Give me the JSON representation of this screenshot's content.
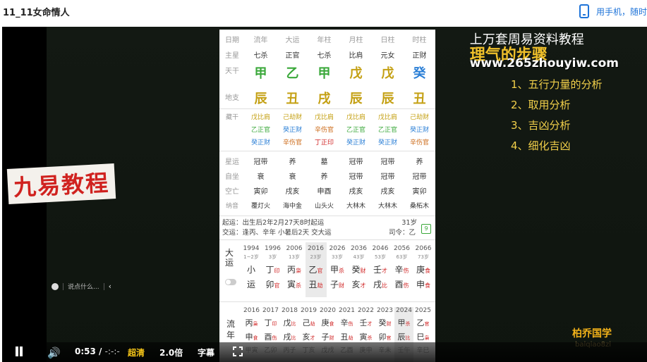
{
  "page": {
    "title": "11_11女命情人",
    "mobile_link": "用手机，随时"
  },
  "video": {
    "brand_banner": "九易教程",
    "watermark": {
      "line1": "上万套周易资料教程",
      "line2": "理气的步骤",
      "line3": "www.265zhouyiw.com"
    },
    "steps": [
      "1、五行力量的分析",
      "2、取用分析",
      "3、吉凶分析",
      "4、细化吉凶"
    ],
    "bottom_brand": "柏乔国学",
    "bottom_brand_pinyin": "baiqiao8zi"
  },
  "chart": {
    "header": [
      "日期",
      "流年",
      "大运",
      "年柱",
      "月柱",
      "日柱",
      "时柱"
    ],
    "zhuxing": {
      "label": "主星",
      "values": [
        "七杀",
        "正官",
        "七杀",
        "比肩",
        "元女",
        "正财"
      ]
    },
    "tiangan": {
      "label": "天干",
      "values": [
        "甲",
        "乙",
        "甲",
        "戊",
        "戊",
        "癸"
      ]
    },
    "dizhi": {
      "label": "地支",
      "values": [
        "辰",
        "丑",
        "戌",
        "辰",
        "辰",
        "丑"
      ]
    },
    "canggan": {
      "label": "藏干",
      "cols": [
        [
          "戊比肩",
          "乙正官",
          "癸正财"
        ],
        [
          "己劫财",
          "癸正财",
          "辛伤官"
        ],
        [
          "戊比肩",
          "辛伤官",
          "丁正印"
        ],
        [
          "戊比肩",
          "乙正官",
          "癸正财"
        ],
        [
          "戊比肩",
          "乙正官",
          "癸正财"
        ],
        [
          "己劫财",
          "癸正财",
          "辛伤官"
        ]
      ]
    },
    "xingyun": {
      "label": "星运",
      "values": [
        "冠带",
        "养",
        "墓",
        "冠带",
        "冠带",
        "养"
      ]
    },
    "zizuo": {
      "label": "自坐",
      "values": [
        "衰",
        "衰",
        "养",
        "冠带",
        "冠带",
        "冠带"
      ]
    },
    "kongwang": {
      "label": "空亡",
      "values": [
        "寅卯",
        "戌亥",
        "申酉",
        "戌亥",
        "戌亥",
        "寅卯"
      ]
    },
    "nayin": {
      "label": "纳音",
      "values": [
        "覆灯火",
        "海中金",
        "山头火",
        "大林木",
        "大林木",
        "桑柘木"
      ]
    },
    "qiyun": "起运：出生后2年2月27天8时起运",
    "jiaoyun": "交运：逢丙、辛年 小暑后2天 交大运",
    "qiyun_age": "31岁",
    "siling": "司令：乙",
    "badge": "9",
    "dayun": {
      "label": "大运",
      "cols": [
        {
          "year": "1994",
          "age": "1~2岁",
          "gan": "小",
          "zhi": "运",
          "gan_ss": "",
          "zhi_ss": ""
        },
        {
          "year": "1996",
          "age": "3岁",
          "gan": "丁",
          "zhi": "卯",
          "gan_ss": "印",
          "zhi_ss": "官"
        },
        {
          "year": "2006",
          "age": "13岁",
          "gan": "丙",
          "zhi": "寅",
          "gan_ss": "枭",
          "zhi_ss": "杀"
        },
        {
          "year": "2016",
          "age": "23岁",
          "gan": "乙",
          "zhi": "丑",
          "gan_ss": "官",
          "zhi_ss": "劫"
        },
        {
          "year": "2026",
          "age": "33岁",
          "gan": "甲",
          "zhi": "子",
          "gan_ss": "杀",
          "zhi_ss": "财"
        },
        {
          "year": "2036",
          "age": "43岁",
          "gan": "癸",
          "zhi": "亥",
          "gan_ss": "财",
          "zhi_ss": "才"
        },
        {
          "year": "2046",
          "age": "53岁",
          "gan": "壬",
          "zhi": "戌",
          "gan_ss": "才",
          "zhi_ss": "比"
        },
        {
          "year": "2056",
          "age": "63岁",
          "gan": "辛",
          "zhi": "酉",
          "gan_ss": "伤",
          "zhi_ss": "伤"
        },
        {
          "year": "2066",
          "age": "73岁",
          "gan": "庚",
          "zhi": "申",
          "gan_ss": "食",
          "zhi_ss": "食"
        }
      ]
    },
    "liunian": {
      "label": "流年",
      "cols": [
        {
          "year": "2016",
          "gan": "丙",
          "gan_ss": "枭",
          "zhi": "申",
          "zhi_ss": "食",
          "sub": "甲寅"
        },
        {
          "year": "2017",
          "gan": "丁",
          "gan_ss": "印",
          "zhi": "酉",
          "zhi_ss": "伤",
          "sub": "乙卯"
        },
        {
          "year": "2018",
          "gan": "戊",
          "gan_ss": "比",
          "zhi": "戌",
          "zhi_ss": "比",
          "sub": "丙子"
        },
        {
          "year": "2019",
          "gan": "己",
          "gan_ss": "劫",
          "zhi": "亥",
          "zhi_ss": "才",
          "sub": "丁亥"
        },
        {
          "year": "2020",
          "gan": "庚",
          "gan_ss": "食",
          "zhi": "子",
          "zhi_ss": "财",
          "sub": "戊戌"
        },
        {
          "year": "2021",
          "gan": "辛",
          "gan_ss": "伤",
          "zhi": "丑",
          "zhi_ss": "劫",
          "sub": "乙酉"
        },
        {
          "year": "2022",
          "gan": "壬",
          "gan_ss": "才",
          "zhi": "寅",
          "zhi_ss": "杀",
          "sub": "庚申"
        },
        {
          "year": "2023",
          "gan": "癸",
          "gan_ss": "财",
          "zhi": "卯",
          "zhi_ss": "官",
          "sub": "辛未"
        },
        {
          "year": "2024",
          "gan": "甲",
          "gan_ss": "杀",
          "zhi": "辰",
          "zhi_ss": "比",
          "sub": "壬午"
        },
        {
          "year": "2025",
          "gan": "乙",
          "gan_ss": "官",
          "zhi": "巳",
          "zhi_ss": "枭",
          "sub": "辛巳"
        }
      ]
    }
  },
  "player": {
    "comment_placeholder": "说点什么...",
    "time_current": "0:53",
    "time_duration": "-:-:-",
    "quality": "超清",
    "speed": "2.0倍",
    "subtitle": "字幕"
  },
  "colors": {
    "accent_yellow": "#f5c518",
    "link_blue": "#1e73d8",
    "banner_red": "#d0221f"
  }
}
